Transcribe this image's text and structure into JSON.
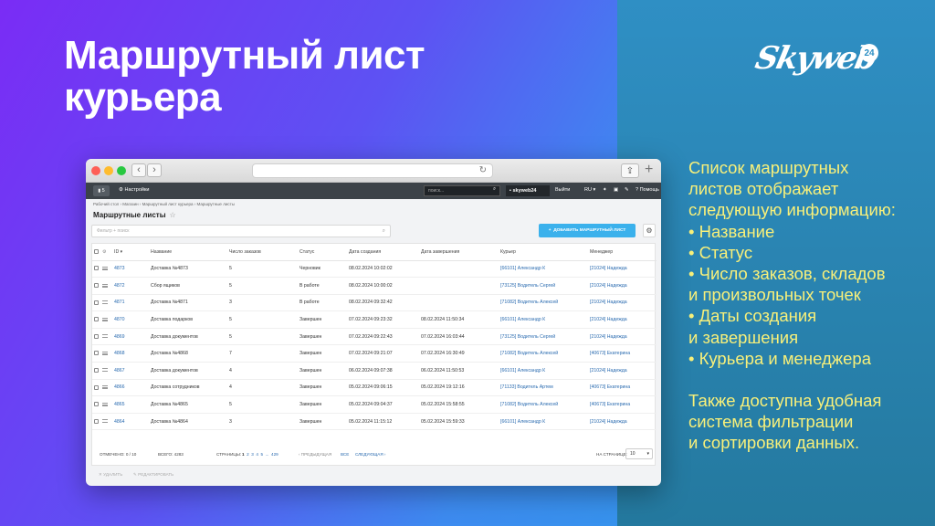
{
  "slide": {
    "title_line1": "Маршрутный лист",
    "title_line2": "курьера",
    "logo_text": "Skyweb",
    "logo_badge": "24",
    "description": [
      "Список маршрутных",
      "листов отображает",
      "следующую информацию:",
      "• Название",
      "• Статус",
      "• Число заказов, складов",
      "и произвольных точек",
      "• Даты создания",
      "и завершения",
      "• Курьера и менеджера"
    ],
    "description2": [
      "Также доступна удобная",
      "система фильтрации",
      "и сортировки данных."
    ]
  },
  "appbar": {
    "bell_count": "5",
    "settings": "Настройки",
    "search_placeholder": "поиск...",
    "user": "skyweb24",
    "logout": "Выйти",
    "lang": "RU",
    "help": "Помощь"
  },
  "breadcrumb": "Рабочий стол  ›  Магазин  ›  Маршрутный лист курьера  ›  Маршрутные листы",
  "page_title": "Маршрутные листы",
  "filter_placeholder": "Фильтр + поиск",
  "add_button": "ДОБАВИТЬ МАРШРУТНЫЙ ЛИСТ",
  "columns": [
    "ID",
    "Название",
    "Число заказов",
    "Статус",
    "Дата создания",
    "Дата завершения",
    "Курьер",
    "Менеджер"
  ],
  "rows": [
    [
      "4873",
      "Доставка №4873",
      "5",
      "Черновик",
      "08.02.2024 10:02:02",
      "",
      "[66101] Александр К",
      "[21024] Надежда"
    ],
    [
      "4872",
      "Сбор ящиков",
      "5",
      "В работе",
      "08.02.2024 10:00:02",
      "",
      "[73125] Водитель Сергей",
      "[21024] Надежда"
    ],
    [
      "4871",
      "Доставка №4871",
      "3",
      "В работе",
      "08.02.2024 09:32:42",
      "",
      "[71082] Водитель Алексей",
      "[21024] Надежда"
    ],
    [
      "4870",
      "Доставка подарков",
      "5",
      "Завершен",
      "07.02.2024 09:23:32",
      "08.02.2024 11:50:34",
      "[66101] Александр К",
      "[21024] Надежда"
    ],
    [
      "4869",
      "Доставка документов",
      "5",
      "Завершен",
      "07.02.2024 09:22:43",
      "07.02.2024 16:03:44",
      "[73125] Водитель Сергей",
      "[21024] Надежда"
    ],
    [
      "4868",
      "Доставка №4868",
      "7",
      "Завершен",
      "07.02.2024 09:21:07",
      "07.02.2024 16:30:49",
      "[71082] Водитель Алексей",
      "[40673] Екатерина"
    ],
    [
      "4867",
      "Доставка документов",
      "4",
      "Завершен",
      "06.02.2024 09:07:38",
      "06.02.2024 11:50:53",
      "[66101] Александр К",
      "[21024] Надежда"
    ],
    [
      "4866",
      "Доставка сотрудников",
      "4",
      "Завершен",
      "05.02.2024 09:06:15",
      "05.02.2024 19:12:16",
      "[71133] Водитель Артем",
      "[40673] Екатерина"
    ],
    [
      "4865",
      "Доставка №4865",
      "5",
      "Завершен",
      "05.02.2024 09:04:37",
      "05.02.2024 15:58:55",
      "[71082] Водитель Алексей",
      "[40673] Екатерина"
    ],
    [
      "4864",
      "Доставка №4864",
      "3",
      "Завершен",
      "05.02.2024 11:15:12",
      "05.02.2024 15:59:33",
      "[66101] Александр К",
      "[21024] Надежда"
    ]
  ],
  "footer": {
    "selected": "ОТМЕЧЕНО: 0 / 10",
    "total": "ВСЕГО: 4283",
    "pages_label": "СТРАНИЦЫ:",
    "pages": [
      "1",
      "2",
      "3",
      "4",
      "5",
      "...",
      "429"
    ],
    "prev": "‹ ПРЕДЫДУЩАЯ",
    "all": "ВСЕ",
    "next": "СЛЕДУЮЩАЯ ›",
    "per_page_label": "НА СТРАНИЦЕ:",
    "per_page_value": "10"
  },
  "actions": {
    "delete": "✕ УДАЛИТЬ",
    "edit": "✎ РЕДАКТИРОВАТЬ"
  }
}
